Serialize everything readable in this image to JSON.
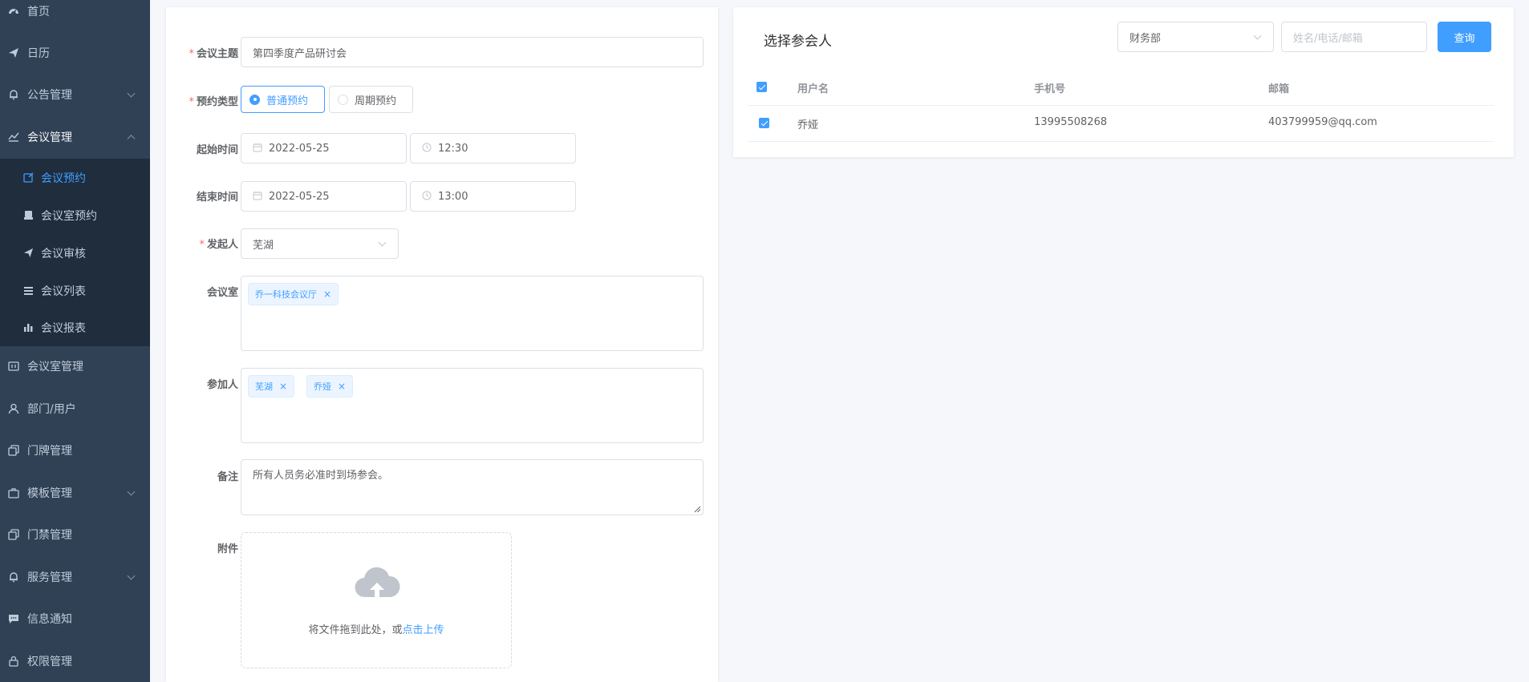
{
  "sidebar": {
    "items": [
      {
        "label": "首页",
        "icon": "dashboard-icon"
      },
      {
        "label": "日历",
        "icon": "send-icon"
      },
      {
        "label": "公告管理",
        "icon": "bell-icon"
      },
      {
        "label": "会议管理",
        "icon": "chart-line-icon"
      },
      {
        "label": "会议室管理",
        "icon": "board-icon"
      },
      {
        "label": "部门/用户",
        "icon": "user-icon"
      },
      {
        "label": "门牌管理",
        "icon": "copy-icon"
      },
      {
        "label": "模板管理",
        "icon": "briefcase-icon"
      },
      {
        "label": "门禁管理",
        "icon": "copy-icon"
      },
      {
        "label": "服务管理",
        "icon": "bell-icon"
      },
      {
        "label": "信息通知",
        "icon": "message-icon"
      },
      {
        "label": "权限管理",
        "icon": "lock-icon"
      }
    ],
    "submenu": [
      {
        "label": "会议预约",
        "icon": "edit-icon"
      },
      {
        "label": "会议室预约",
        "icon": "print-icon"
      },
      {
        "label": "会议审核",
        "icon": "send-icon"
      },
      {
        "label": "会议列表",
        "icon": "list-icon"
      },
      {
        "label": "会议报表",
        "icon": "bar-chart-icon"
      }
    ]
  },
  "form": {
    "topic_label": "会议主题",
    "topic_value": "第四季度产品研讨会",
    "type_label": "预约类型",
    "type_options": [
      "普通预约",
      "周期预约"
    ],
    "type_selected": "普通预约",
    "start_label": "起始时间",
    "start_date": "2022-05-25",
    "start_time": "12:30",
    "end_label": "结束时间",
    "end_date": "2022-05-25",
    "end_time": "13:00",
    "initiator_label": "发起人",
    "initiator_value": "芜湖",
    "room_label": "会议室",
    "room_tags": [
      "乔一科技会议厅"
    ],
    "participants_label": "参加人",
    "participant_tags": [
      "芜湖",
      "乔娅"
    ],
    "remark_label": "备注",
    "remark_value": "所有人员务必准时到场参会。",
    "attach_label": "附件",
    "upload_text": "将文件拖到此处，或",
    "upload_link": "点击上传"
  },
  "participant_panel": {
    "title": "选择参会人",
    "department_value": "财务部",
    "search_placeholder": "姓名/电话/邮箱",
    "search_button": "查询",
    "columns": [
      "用户名",
      "手机号",
      "邮箱"
    ],
    "rows": [
      {
        "username": "乔娅",
        "phone": "13995508268",
        "email": "403799959@qq.com"
      }
    ]
  },
  "colors": {
    "sidebar_bg": "#304156",
    "submenu_bg": "#1f2d3d",
    "accent": "#409eff",
    "required": "#f56c6c"
  }
}
